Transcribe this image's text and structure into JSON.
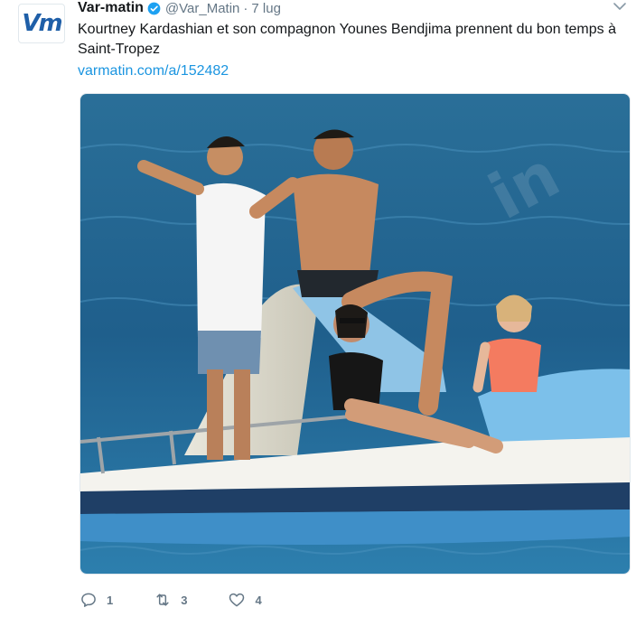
{
  "tweet": {
    "author_name": "Var-matin",
    "avatar_text": "Vm",
    "handle": "@Var_Matin",
    "separator": "·",
    "date": "7 lug",
    "text": "Kourtney Kardashian et son compagnon Younes Bendjima prennent du bon temps à Saint-Tropez",
    "link": "varmatin.com/a/152482",
    "actions": {
      "replies": "1",
      "retweets": "3",
      "likes": "4"
    }
  },
  "icons": {
    "verified": "verified-badge-icon",
    "more": "chevron-down-icon",
    "reply": "reply-icon",
    "retweet": "retweet-icon",
    "like": "heart-icon"
  },
  "colors": {
    "link": "#1b95e0",
    "verified": "#1da1f2",
    "muted": "#657786",
    "sea": "#1f6f9f",
    "boat": "#4aa3d8"
  }
}
